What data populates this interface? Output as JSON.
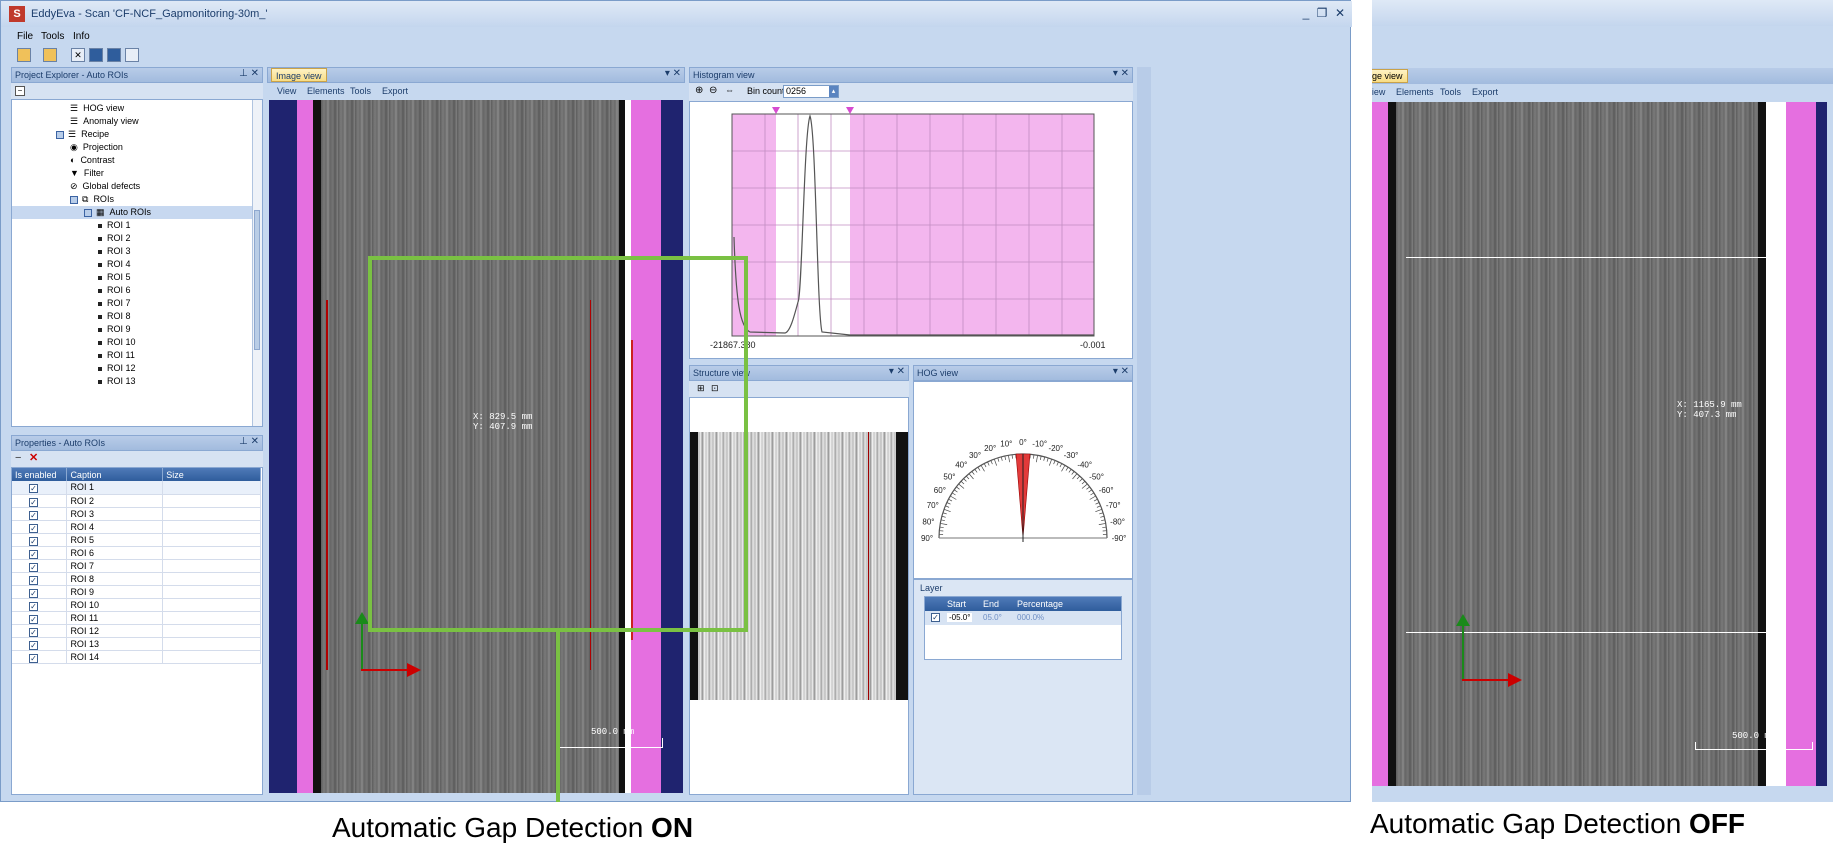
{
  "app": {
    "title": "EddyEva - Scan 'CF-NCF_Gapmonitoring-30m_'",
    "window_buttons": [
      "_",
      "❐",
      "✕"
    ],
    "menu": [
      "File",
      "Tools",
      "Info"
    ]
  },
  "project_explorer": {
    "title": "Project Explorer - Auto ROIs",
    "tree": [
      {
        "label": "HOG view",
        "level": 4,
        "icon": "list-icon"
      },
      {
        "label": "Anomaly view",
        "level": 4,
        "icon": "list-icon"
      },
      {
        "label": "Recipe",
        "level": 3,
        "icon": "list-icon"
      },
      {
        "label": "Projection",
        "level": 4,
        "icon": "camera-icon"
      },
      {
        "label": "Contrast",
        "level": 4,
        "icon": "contrast-icon"
      },
      {
        "label": "Filter",
        "level": 4,
        "icon": "filter-icon"
      },
      {
        "label": "Global defects",
        "level": 4,
        "icon": "block-icon"
      },
      {
        "label": "ROIs",
        "level": 4,
        "icon": "roi-icon"
      },
      {
        "label": "Auto ROIs",
        "level": 5,
        "icon": "grid-icon",
        "selected": true
      },
      {
        "label": "ROI 1",
        "level": 6
      },
      {
        "label": "ROI 2",
        "level": 6
      },
      {
        "label": "ROI 3",
        "level": 6
      },
      {
        "label": "ROI 4",
        "level": 6
      },
      {
        "label": "ROI 5",
        "level": 6
      },
      {
        "label": "ROI 6",
        "level": 6
      },
      {
        "label": "ROI 7",
        "level": 6
      },
      {
        "label": "ROI 8",
        "level": 6
      },
      {
        "label": "ROI 9",
        "level": 6
      },
      {
        "label": "ROI 10",
        "level": 6
      },
      {
        "label": "ROI 11",
        "level": 6
      },
      {
        "label": "ROI 12",
        "level": 6
      },
      {
        "label": "ROI 13",
        "level": 6
      }
    ]
  },
  "properties": {
    "title": "Properties - Auto ROIs",
    "columns": [
      "Is enabled",
      "Caption",
      "Size"
    ],
    "rows": [
      "ROI 1",
      "ROI 2",
      "ROI 3",
      "ROI 4",
      "ROI 5",
      "ROI 6",
      "ROI 7",
      "ROI 8",
      "ROI 9",
      "ROI 10",
      "ROI 11",
      "ROI 12",
      "ROI 13",
      "ROI 14"
    ]
  },
  "image_view": {
    "tab": "Image view",
    "toolbar": [
      "View",
      "Elements",
      "Tools",
      "Export"
    ],
    "coord_x": "X: 829.5 mm",
    "coord_y": "Y: 407.9 mm",
    "scale": "500.0 mm"
  },
  "histogram_view": {
    "tab": "Histogram view",
    "bin_label": "Bin count",
    "bin_value": "0256",
    "x_min": "-21867.380",
    "x_max": "-0.001"
  },
  "structure_view": {
    "tab": "Structure view"
  },
  "hog_view": {
    "tab": "HOG view",
    "left_labels": [
      "10°",
      "20°",
      "30°",
      "40°",
      "50°",
      "60°",
      "70°",
      "80°",
      "90°"
    ],
    "right_labels": [
      "-10°",
      "-20°",
      "-30°",
      "-40°",
      "-50°",
      "-60°",
      "-70°",
      "-80°",
      "-90°"
    ],
    "zero": "0°",
    "layer_title": "Layer",
    "layer_columns": [
      "Start",
      "End",
      "Percentage"
    ],
    "layer_row": {
      "start": "-05.0°",
      "end": "05.0°",
      "percentage": "000.0%"
    }
  },
  "right_image_view": {
    "tab": "Image view",
    "toolbar": [
      "View",
      "Elements",
      "Tools",
      "Export"
    ],
    "coord_x": "X: 1165.9 mm",
    "coord_y": "Y: 407.3 mm",
    "scale": "500.0 mm"
  },
  "captions": {
    "on_prefix": "Automatic Gap Detection ",
    "on_bold": "ON",
    "off_prefix": "Automatic Gap Detection ",
    "off_bold": "OFF"
  },
  "colors": {
    "highlight_box": "#7ac143",
    "band_pink": "#e56fe0",
    "band_navy": "#1f236f",
    "axis_red": "#cc0000",
    "axis_green": "#1a8a1a"
  }
}
